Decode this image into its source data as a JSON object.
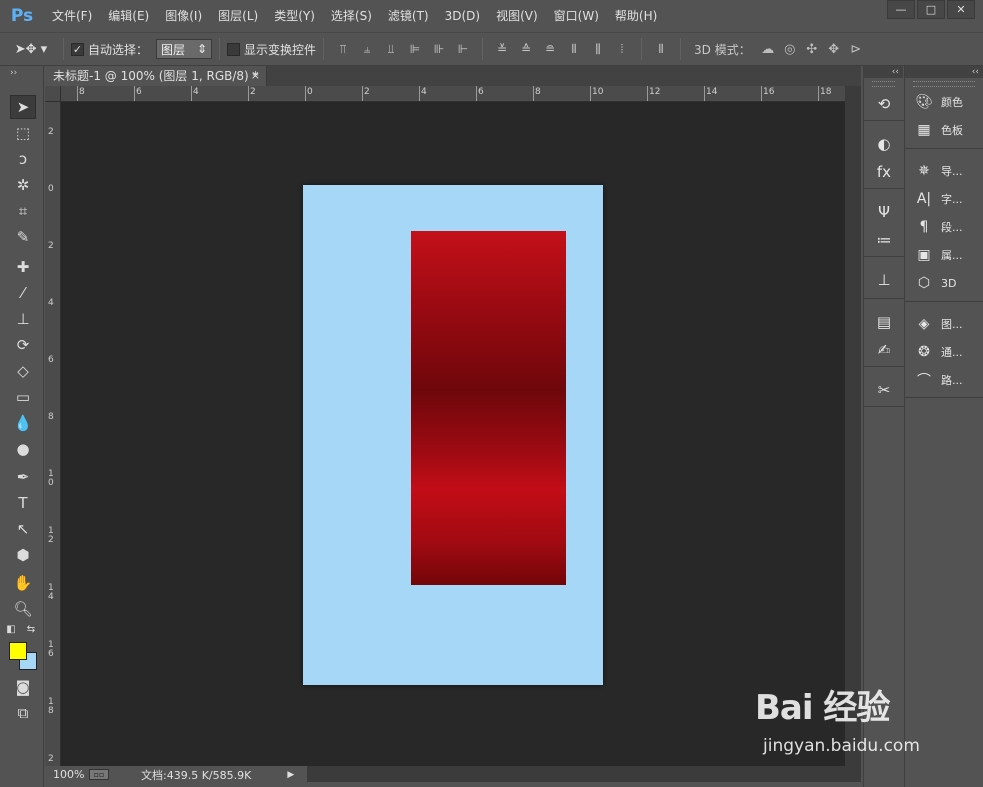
{
  "app": {
    "logo": "Ps",
    "menu": [
      "文件(F)",
      "编辑(E)",
      "图像(I)",
      "图层(L)",
      "类型(Y)",
      "选择(S)",
      "滤镜(T)",
      "3D(D)",
      "视图(V)",
      "窗口(W)",
      "帮助(H)"
    ],
    "window_controls": {
      "minimize": "—",
      "restore": "□",
      "close": "✕"
    }
  },
  "options": {
    "auto_select_label": "自动选择：",
    "auto_select_checked": true,
    "auto_select_value": "图层",
    "show_transform_label": "显示变换控件",
    "mode_3d_label": "3D 模式："
  },
  "document": {
    "tab_title": "未标题-1 @ 100% (图层 1, RGB/8) *",
    "tab_close": "×",
    "background_color": "#a7d7f7",
    "gradient_colors": [
      "#c4101a",
      "#6e070b",
      "#c20d17",
      "#720608"
    ]
  },
  "rulers": {
    "top_labels": [
      "8",
      "6",
      "4",
      "2",
      "0",
      "2",
      "4",
      "6",
      "8",
      "10",
      "12",
      "14",
      "16",
      "18"
    ],
    "left_labels": [
      "2",
      "0",
      "2",
      "4",
      "6",
      "8",
      "1 0",
      "1 2",
      "1 4",
      "1 6",
      "1 8",
      "2"
    ]
  },
  "status": {
    "zoom": "100%",
    "doc_info": "文档:439.5 K/585.9K",
    "arrow": "▶"
  },
  "colors": {
    "foreground": "#ffff00",
    "background": "#a7d7f7"
  },
  "panels": {
    "items": [
      {
        "icon": "palette-icon",
        "label": "颜色"
      },
      {
        "icon": "swatches-icon",
        "label": "色板"
      },
      {
        "icon": "navigator-icon",
        "label": "导..."
      },
      {
        "icon": "character-icon",
        "label": "字..."
      },
      {
        "icon": "paragraph-icon",
        "label": "段..."
      },
      {
        "icon": "properties-icon",
        "label": "属..."
      },
      {
        "icon": "cube-3d-icon",
        "label": "3D"
      },
      {
        "icon": "layers-icon",
        "label": "图..."
      },
      {
        "icon": "channels-icon",
        "label": "通..."
      },
      {
        "icon": "paths-icon",
        "label": "路..."
      }
    ]
  },
  "watermark": {
    "main": "Bai 经验",
    "sub": "jingyan.baidu.com"
  }
}
